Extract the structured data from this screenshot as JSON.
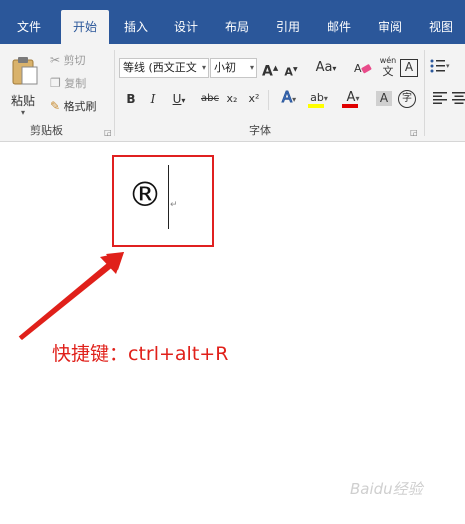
{
  "tabs": [
    {
      "label": "文件"
    },
    {
      "label": "开始"
    },
    {
      "label": "插入"
    },
    {
      "label": "设计"
    },
    {
      "label": "布局"
    },
    {
      "label": "引用"
    },
    {
      "label": "邮件"
    },
    {
      "label": "审阅"
    },
    {
      "label": "视图"
    }
  ],
  "clipboard": {
    "paste_label": "粘贴",
    "cut_label": "剪切",
    "copy_label": "复制",
    "format_painter_label": "格式刷",
    "group_label": "剪贴板"
  },
  "font": {
    "font_name": "等线 (西文正文",
    "font_size": "小初",
    "group_label": "字体",
    "grow_font": "A",
    "shrink_font": "A",
    "change_case": "Aa",
    "phonetic_top": "wén",
    "phonetic_bottom": "文",
    "char_border": "A",
    "bold": "B",
    "italic": "I",
    "underline": "U",
    "strikethrough": "abc",
    "subscript": "x₂",
    "superscript": "x²",
    "text_effects": "A",
    "highlight": "ab",
    "font_color": "A",
    "char_shading": "A",
    "enclose_char": "字"
  },
  "colors": {
    "tab_bar": "#2b579a",
    "ribbon": "#f3f3f3",
    "highlight_yellow": "#ffff00",
    "font_color_red": "#e00000",
    "annotation_red": "#e0201a"
  },
  "document": {
    "symbol": "®",
    "paragraph_mark": "↵"
  },
  "annotation": {
    "text": "快捷键：ctrl+alt+R"
  },
  "watermark": {
    "text": "Baidu经验"
  }
}
